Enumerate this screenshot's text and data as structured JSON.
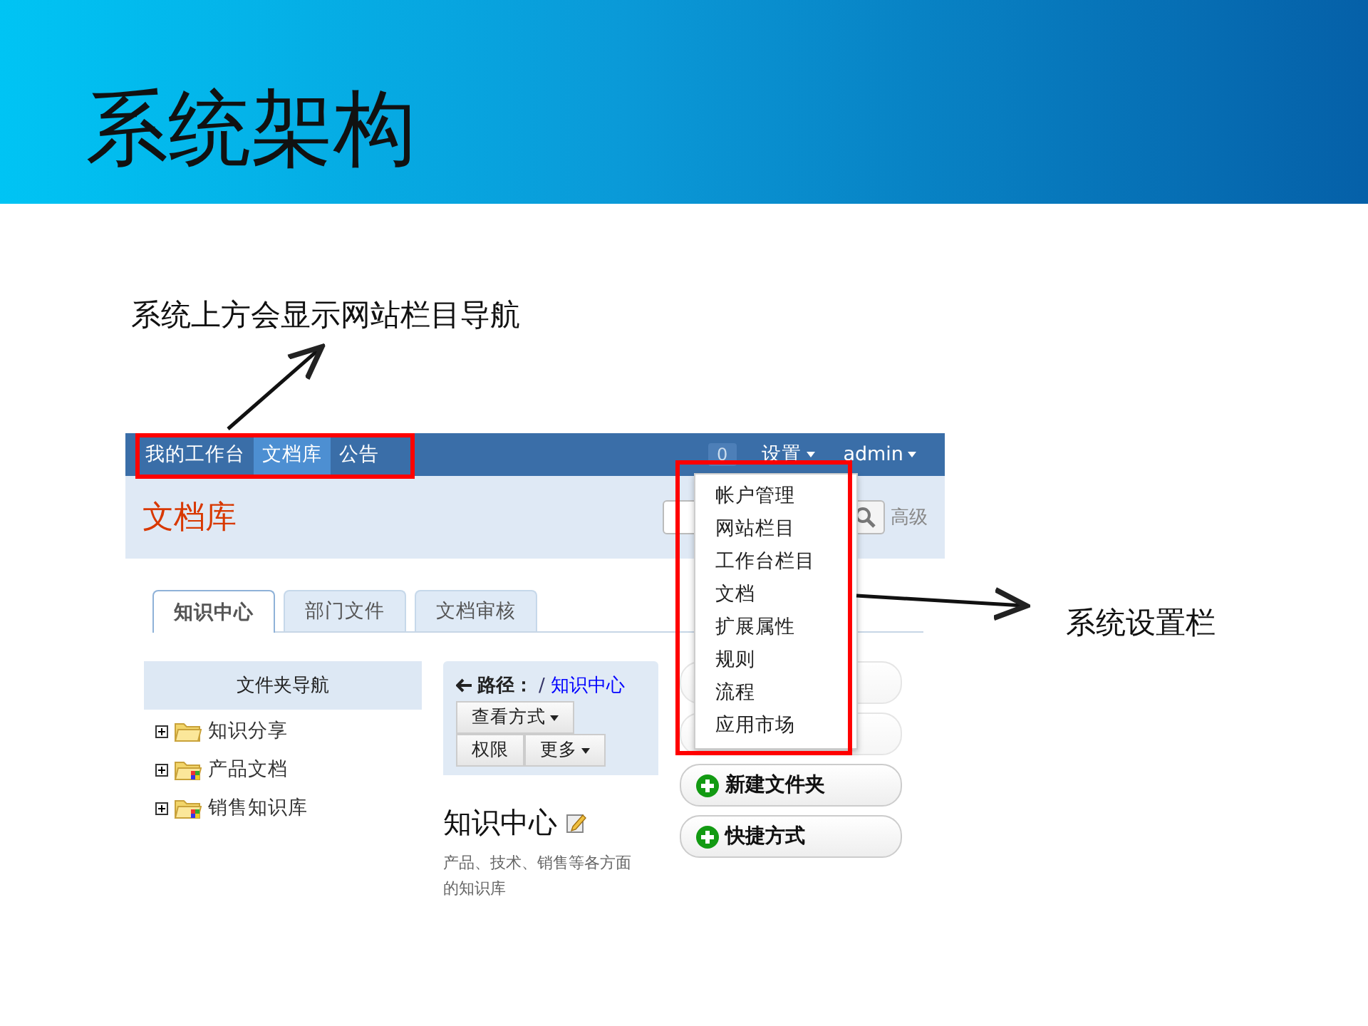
{
  "slide_title": "系统架构",
  "annotations": [
    {
      "text": "系统上方会显示网站栏目导航"
    },
    {
      "text": "系统设置栏"
    }
  ],
  "screenshot": {
    "nav": {
      "items": [
        {
          "label": "我的工作台",
          "selected": false
        },
        {
          "label": "文档库",
          "selected": true
        },
        {
          "label": "公告",
          "selected": false
        }
      ],
      "badge": "0",
      "settings": "设置",
      "user": "admin"
    },
    "header": {
      "title": "文档库",
      "advanced": "高级"
    },
    "tabs": [
      {
        "label": "知识中心",
        "selected": true
      },
      {
        "label": "部门文件",
        "selected": false
      },
      {
        "label": "文档审核",
        "selected": false
      }
    ],
    "folder_nav": {
      "title": "文件夹导航",
      "items": [
        {
          "label": "知识分享",
          "kind": "plain"
        },
        {
          "label": "产品文档",
          "kind": "shared"
        },
        {
          "label": "销售知识库",
          "kind": "shared"
        }
      ]
    },
    "path": {
      "label": "路径：",
      "separator": "/",
      "link": "知识中心",
      "buttons": [
        {
          "label": "查看方式",
          "dropdown": true
        },
        {
          "label": "权限",
          "dropdown": false
        },
        {
          "label": "更多",
          "dropdown": true
        }
      ]
    },
    "folder": {
      "title": "知识中心",
      "description": "产品、技术、销售等各方面的知识库"
    },
    "actions": [
      {
        "label": "新建文件夹"
      },
      {
        "label": "快捷方式"
      }
    ],
    "settings_menu": [
      {
        "label": "帐户管理"
      },
      {
        "label": "网站栏目"
      },
      {
        "label": "工作台栏目"
      },
      {
        "label": "文档"
      },
      {
        "label": "扩展属性"
      },
      {
        "label": "规则"
      },
      {
        "label": "流程"
      },
      {
        "label": "应用市场"
      }
    ]
  }
}
